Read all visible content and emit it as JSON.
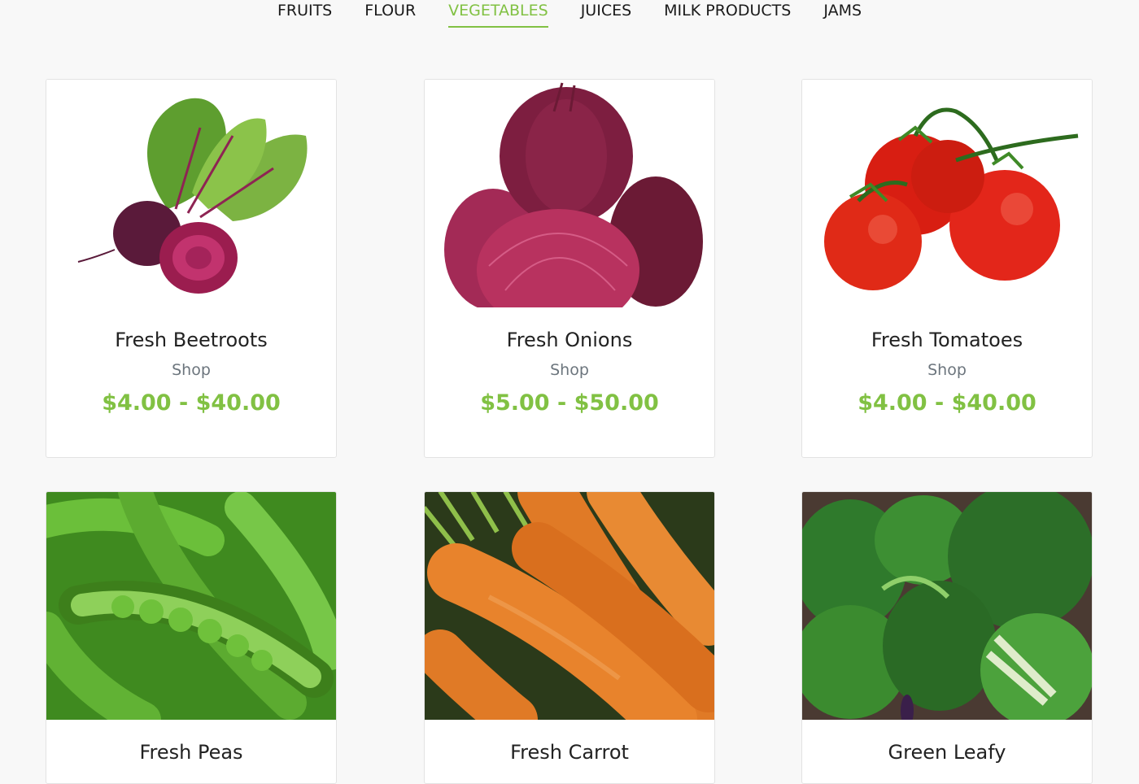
{
  "tabs": [
    {
      "label": "FRUITS",
      "active": false
    },
    {
      "label": "FLOUR",
      "active": false
    },
    {
      "label": "VEGETABLES",
      "active": true
    },
    {
      "label": "JUICES",
      "active": false
    },
    {
      "label": "MILK PRODUCTS",
      "active": false
    },
    {
      "label": "JAMS",
      "active": false
    }
  ],
  "products": [
    {
      "title": "Fresh Beetroots",
      "subtitle": "Shop",
      "price": "$4.00 - $40.00"
    },
    {
      "title": "Fresh Onions",
      "subtitle": "Shop",
      "price": "$5.00 - $50.00"
    },
    {
      "title": "Fresh Tomatoes",
      "subtitle": "Shop",
      "price": "$4.00 - $40.00"
    },
    {
      "title": "Fresh Peas",
      "subtitle": "",
      "price": ""
    },
    {
      "title": "Fresh Carrot",
      "subtitle": "",
      "price": ""
    },
    {
      "title": "Green Leafy",
      "subtitle": "",
      "price": ""
    }
  ],
  "colors": {
    "accent": "#81c143",
    "tab_text": "#1a1a1a",
    "muted": "#6c757d"
  }
}
